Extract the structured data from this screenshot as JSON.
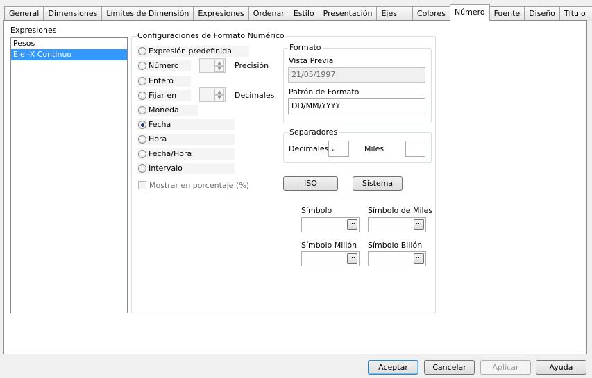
{
  "tabs": [
    "General",
    "Dimensiones",
    "Límites de Dimensión",
    "Expresiones",
    "Ordenar",
    "Estilo",
    "Presentación",
    "Ejes",
    "Colores",
    "Número",
    "Fuente",
    "Diseño",
    "Título"
  ],
  "active_tab": "Número",
  "expressions": {
    "label": "Expresiones",
    "items": [
      "Pesos",
      "Eje -X Continuo"
    ],
    "selected": "Eje -X Continuo"
  },
  "number_format": {
    "title": "Configuraciones de Formato Numérico",
    "options": {
      "predefined": "Expresión predefinida",
      "number": "Número",
      "integer": "Entero",
      "fixed": "Fijar en",
      "currency": "Moneda",
      "date": "Fecha",
      "time": "Hora",
      "datetime": "Fecha/Hora",
      "interval": "Intervalo"
    },
    "selected_option": "Fecha",
    "precision_label": "Precisión",
    "decimals_label": "Decimales",
    "show_percent_label": "Mostrar en porcentaje (%)",
    "show_percent_checked": false
  },
  "format": {
    "title": "Formato",
    "preview_label": "Vista Previa",
    "preview_value": "21/05/1997",
    "pattern_label": "Patrón de Formato",
    "pattern_value": "DD/MM/YYYY"
  },
  "separators": {
    "title": "Separadores",
    "decimals_label": "Decimales",
    "decimals_value": ",",
    "thousands_label": "Miles",
    "thousands_value": ""
  },
  "buttons": {
    "iso": "ISO",
    "system": "Sistema",
    "ok": "Aceptar",
    "cancel": "Cancelar",
    "apply": "Aplicar",
    "help": "Ayuda"
  },
  "symbols": {
    "symbol_label": "Símbolo",
    "thousands_symbol_label": "Símbolo de Miles",
    "million_symbol_label": "Símbolo Millón",
    "billion_symbol_label": "Símbolo Billón",
    "browse_glyph": "..."
  }
}
